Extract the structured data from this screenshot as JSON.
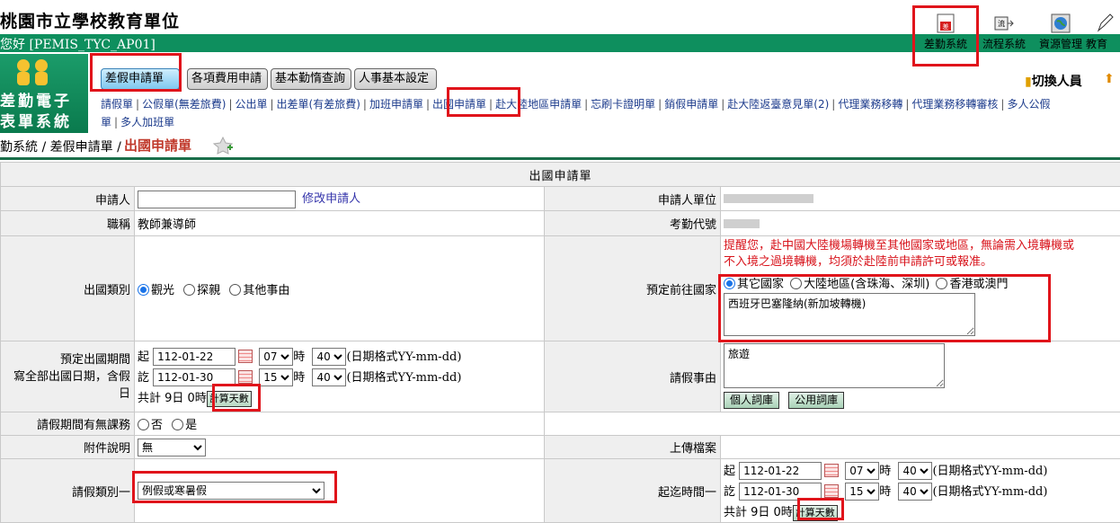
{
  "header": {
    "site_title": "桃園市立學校教育單位",
    "greeting": "您好 [PEMIS_TYC_AP01]",
    "top_icons": [
      {
        "label": "差勤系統",
        "icon": "attendance-icon"
      },
      {
        "label": "流程系統",
        "icon": "workflow-icon"
      },
      {
        "label": "資源管理",
        "icon": "resource-globe-icon"
      },
      {
        "label": "教育",
        "icon": "education-pen-icon"
      }
    ],
    "switch_user": "切換人員"
  },
  "logo": {
    "line1": "差勤電子",
    "line2": "表單系統"
  },
  "tabs": [
    "差假申請單",
    "各項費用申請",
    "基本勤惰查詢",
    "人事基本設定"
  ],
  "sublinks": [
    "請假單",
    "公假單(無差旅費)",
    "公出單",
    "出差單(有差旅費)",
    "加班申請單",
    "出國申請單",
    "赴大陸地區申請單",
    "忘刷卡證明單",
    "銷假申請單",
    "赴大陸返臺意見單(2)",
    "代理業務移轉",
    "代理業務移轉審核",
    "多人公假",
    "單",
    "多人加班單"
  ],
  "breadcrumb": {
    "path": "勤系統 / 差假申請單 / ",
    "current": "出國申請單"
  },
  "form": {
    "title": "出國申請單",
    "applicant_label": "申請人",
    "modify_applicant": "修改申請人",
    "unit_label": "申請人單位",
    "title_label": "職稱",
    "title_value": "教師兼導師",
    "code_label": "考勤代號",
    "type_label": "出國類別",
    "type_options": [
      "觀光",
      "探親",
      "其他事由"
    ],
    "type_selected": "觀光",
    "warning": "提醒您，赴中國大陸機場轉機至其他國家或地區，無論需入境轉機或",
    "warning2": "不入境之過境轉機，均須於赴陸前申請許可或報准。",
    "dest_label": "預定前往國家",
    "dest_options": [
      "其它國家",
      "大陸地區(含珠海、深圳)",
      "香港或澳門"
    ],
    "dest_selected": "其它國家",
    "dest_text": "西班牙巴塞隆納(新加坡轉機)",
    "period_label1": "預定出國期間",
    "period_label2": "寫全部出國日期，含假",
    "period_label3": "日",
    "start_prefix": "起",
    "end_prefix": "訖",
    "start_date": "112-01-22",
    "start_hour": "07",
    "start_min": "40",
    "end_date": "112-01-30",
    "end_hour": "15",
    "end_min": "40",
    "hour_unit": "時",
    "date_format": "(日期格式YY-mm-dd)",
    "total_text": "共計  9日 0時",
    "calc_days": "計算天數",
    "reason_label": "請假事由",
    "reason_text": "旅遊",
    "personal_words": "個人詞庫",
    "public_words": "公用詞庫",
    "class_label": "請假期間有無課務",
    "class_options": [
      "否",
      "是"
    ],
    "attach_label": "附件說明",
    "attach_value": "無",
    "upload_label": "上傳檔案",
    "leave_type_label": "請假類別一",
    "leave_type_value": "例假或寒暑假",
    "time_label": "起迄時間一",
    "t1_start_date": "112-01-22",
    "t1_start_hour": "07",
    "t1_start_min": "40",
    "t1_end_date": "112-01-30",
    "t1_end_hour": "15",
    "t1_end_min": "40",
    "t1_total": "共計  9日 0時"
  },
  "colors": {
    "brand_green": "#0e8f5e",
    "highlight_red": "#e0141b",
    "link_blue": "#1c3b8c",
    "warning_red": "#d8131b"
  }
}
